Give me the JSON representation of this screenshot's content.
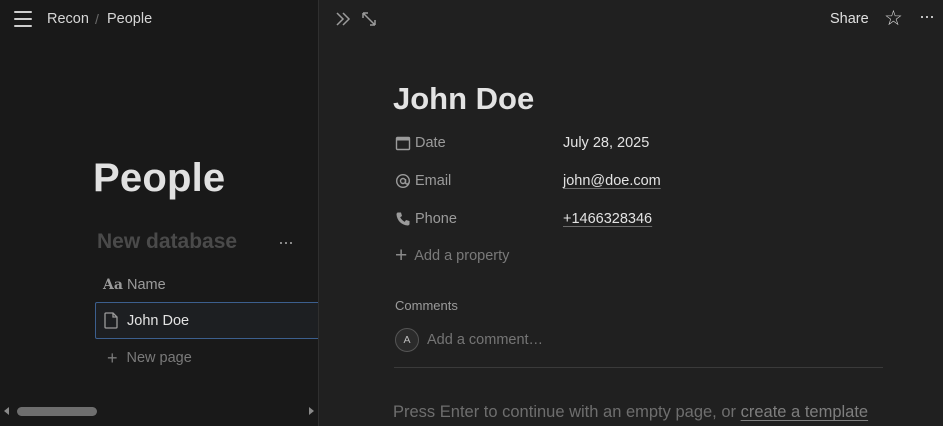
{
  "breadcrumb": {
    "workspace": "Recon",
    "separator": "/",
    "current": "People"
  },
  "left_pane": {
    "page_title": "People",
    "database_title": "New database",
    "more_label": "···",
    "column_header": {
      "icon": "text-aa-icon",
      "icon_glyph": "Aa",
      "label": "Name"
    },
    "rows": [
      {
        "icon": "document-icon",
        "label": "John Doe"
      }
    ],
    "new_page_label": "New page"
  },
  "topbar_right": {
    "share_label": "Share",
    "star_glyph": "☆",
    "more_glyph": "···"
  },
  "page": {
    "title": "John Doe",
    "properties": [
      {
        "icon": "calendar-icon",
        "label": "Date",
        "value": "July 28, 2025",
        "is_link": false
      },
      {
        "icon": "at-sign-icon",
        "label": "Email",
        "value": "john@doe.com",
        "is_link": true
      },
      {
        "icon": "phone-icon",
        "label": "Phone",
        "value": "+1466328346",
        "is_link": true
      }
    ],
    "add_property_label": "Add a property",
    "comments": {
      "label": "Comments",
      "avatar_initial": "A",
      "placeholder": "Add a comment…"
    },
    "hint": {
      "text": "Press Enter to continue with an empty page, or ",
      "link": "create a template"
    }
  },
  "colors": {
    "background_left": "#191919",
    "background_right": "#202020",
    "selection_border": "#3c5f8e"
  }
}
